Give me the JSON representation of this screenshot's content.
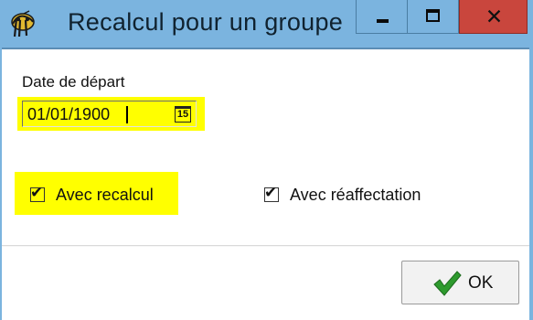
{
  "window": {
    "title": "Recalcul pour un groupe",
    "close_glyph": "✕"
  },
  "form": {
    "date_label": "Date de départ",
    "date_value": "01/01/1900",
    "calendar_icon_text": "15",
    "avec_recalcul_label": "Avec recalcul",
    "avec_recalcul_checked": true,
    "avec_reaffectation_label": "Avec réaffectation",
    "avec_reaffectation_checked": true,
    "check_glyph": "✔"
  },
  "footer": {
    "ok_label": "OK"
  },
  "colors": {
    "titlebar": "#7bb4df",
    "close_button": "#c9463d",
    "highlight": "#ffff00",
    "ok_check": "#2e9a2e"
  },
  "icons": {
    "app": "app-logo-icon",
    "minimize": "minimize-icon",
    "maximize": "maximize-icon",
    "close": "close-icon",
    "calendar": "calendar-icon",
    "ok": "checkmark-icon"
  }
}
